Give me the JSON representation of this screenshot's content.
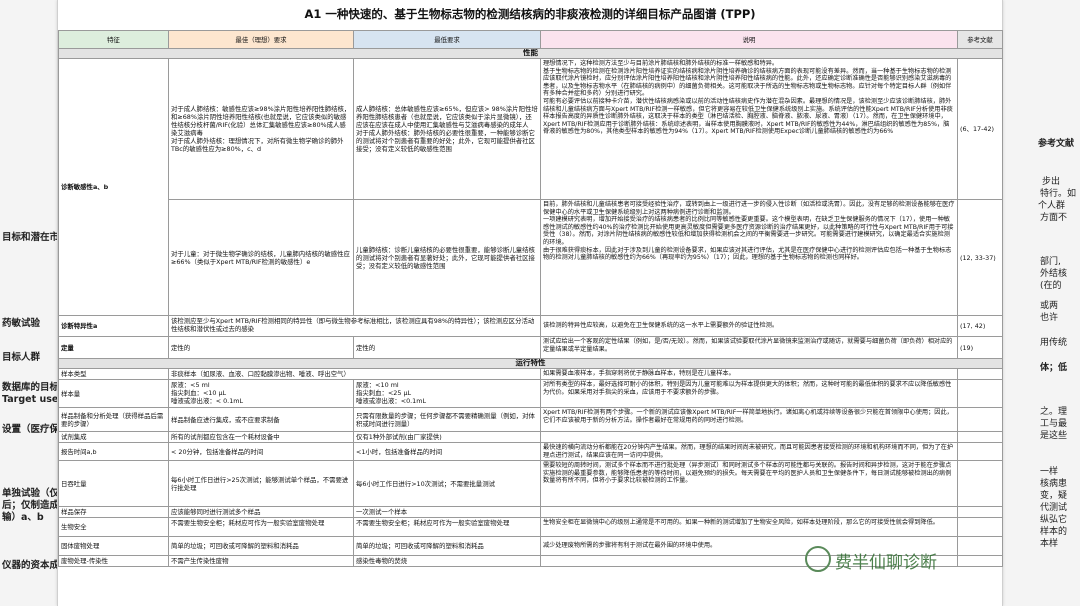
{
  "title": "A1 一种快速的、基于生物标志物的检测结核病的非痰液检测的详细目标产品图谱 (TPP)",
  "headers": [
    "特征",
    "最佳（理想）要求",
    "最低要求",
    "说明",
    "参考文献"
  ],
  "sections": {
    "performance": "性能",
    "operational": "运行特性"
  },
  "rows": {
    "adult": {
      "feat": "诊断敏感性a、b",
      "opt": "对于成人肺结核：敏感性应该≥98%涂片阳性培养阳性肺结核，和≥68%涂片阴性培养阳性结核(也就是说，它应该类似的敏感性结核分枝杆菌/RIF(化验）总体汇集敏感性应该≥80%成人感染艾滋病毒\n对于成人肺外结核：理想情况下，对所有微生物学确诊的肺外TBc的敏感性应为≥80%，c、d",
      "min": "成人肺结核：总体敏感性应该≥65%，但应该> 98%涂片阳性培养阳性肺结核患者（也就是说，它应该类似于涂片显微镜），还应该在应该在成人中使用汇集敏感性与艾滋病毒感染的成年人\n对于成人肺外结核：肺外结核的必要性很重要，一种能够诊断它的测试将对个别患者有重要的好处；此外，它现可能提供者社区接受；没有定义较低的敏感性范围",
      "desc": "理想情况下，这种检测方法至少与目前涂片肺结核和肺外结核的标准一样敏感和特异。\n基于生物标志物的检测在检测涂片阳性培养证实的结核病和涂片阴性培养确诊的结核病方面的表现可能没有差异。然而，当一种基于生物标志物的检测应该取代涂片镜检时，应分别评估涂片阳性培养阳性结核和涂片阴性培养阳性结核病的性能。此外，还应确定诊断准确性是否能够识别感染艾滋病毒的患者，以及生物标志物水平（在肺结核的病例中）的细菌负荷相关。这可能取决于所选的生物标志物或生物标志物。应针对每个特定目标人群（例如伴有多种合并症和多药）分别进行研究。\n可能有必要评估以前接种卡介苗，潜伏性结核病感染或以前的活动性结核病史作为潜在混杂因素。最理想的情况是，该检测至少应该诊断肺结核，肺外结核和儿童结核病方面与Xpert MTB/RIF检测一样敏感，但它将更容易在较低卫生保健系统级别上实施。系统评估的性能Xpert MTB/RIF分析使用非痰样本报告高度的异质性诊断肺外结核，这取决于样本的类型（淋巴结活检、胸腔液、脑脊液、脓液、尿液、胃液）（17）。然而，在卫生保健环境中，Xpert MTB/RIF检测应用于诊断肺外结核：系统综述表明，当样本使用胸膜液时，Xpert MTB/RIF的敏感性为44%，淋巴结组织的敏感性为85%，脑脊液的敏感性为80%，其他类型样本的敏感性为94%（17）。Xpert MTB/RIF检测使用Expec诊断儿童肺结核的敏感性约为66%",
      "ref": "(6、17-42)"
    },
    "child": {
      "opt": "对于儿童：对于微生物学确诊的结核，儿童肺内结核的敏感性应≥66%（类似于Xpert MTB/RIF检测的敏感性）e",
      "min": "儿童肺结核：诊断儿童结核的必要性很重要，能够诊断儿童结核的测试将对个别患者有显著好处；此外，它现可能提供者社区接受；没有定义较低的敏感性范围",
      "desc": "目前，肺外结核和儿童结核患者可接受经验性治疗，或转到由上一级进行进一步的侵入性诊断（如活检或洗胃）。因此，没有足够的检测设备能够在医疗保健中心的水平或卫生保健系统级别上对这两种病例进行诊断和监测。\n一项建模研究表明，增加开始接受治疗的结核病患者的比例比同等敏感性要更重要。这个模型表明，在缺乏卫生保健服务的情况下（17），使用一种敏感性测试的敏感性约40%的治疗检测比开始使用更高灵敏度但需要更多医疗资源诊断的治疗结果更好，以此种策略的可行性与Xpert MTB/RIF用于可接受性（38）。然而，对涂片阴性结核病的敏感性较低和增加获得检测机会之间的平衡需要进一步研究。可能需要进行建模研究，以确定最适合实施检测的环境。\n由于很难获得痰标本，因此对于涉及到儿童的检测设备要求，如果应该对其进行评估，尤其是在医疗保健中心进行的检测评估应包括一种基于生物标志物的检测对儿童肺结核的敏感性约为66%（再现率约为95%）（17）；因此，理想的基于生物标志物的检测也同样好。",
      "ref": "(12, 33-37)"
    },
    "spec": {
      "feat": "诊断特异性a",
      "opt": "该检测应至少与Xpert MTB/RIF检测相同的特异性（即与微生物参考标准相比，该检测应具有98%的特异性）；该检测应区分活动性结核和潜伏性或过去的感染",
      "desc": "该检测的特异性应较高，以避免在卫生保健系统的这一水平上需要额外的验证性检测。",
      "ref": "(17, 42)"
    },
    "quant": {
      "feat": "定量",
      "opt": "定性的",
      "min": "定性的",
      "desc": "测试应给出一个客观的定性结果（例如，是/否/无效）。然而，如果该试验要取代涂片显微镜来监测治疗或随访，就需要与细菌负荷（即负荷）相对应的定量结果或半定量结果。",
      "ref": "(19)"
    },
    "sample": {
      "feat": "样本类型",
      "opt": "非痰样本（如尿液、血液、口腔黏膜渗出物、唾液、呼出空气）",
      "desc": "如果需要血液样本，手指穿刺将优于静脉血样本，特别是在儿童样本。"
    },
    "vol": {
      "feat": "样本量",
      "opt": "尿液：<5 ml\n指尖刺血：<10 μL\n唾液或渗出液：< 0.1mL",
      "min": "尿液：<10 ml\n指尖刺血：<25 μL\n唾液或渗出液：<0.1mL",
      "desc": "对所有类型的样本，最好选择可耐小的体积，特别是因为儿童可能难以为样本提供更大的体积；然而，这种时可能的最低体积的要求不应以降低敏感性为代价。如果采用对手指尖的采血，应该用于不要求额外的步骤。"
    },
    "prep": {
      "feat": "样品制备和分析处理（获得样品后需要的步骤）",
      "opt": "样品制备应进行集成，或不应要求制备",
      "min": "只需有限数量的步骤；任何步骤都不需要精确测量（例如，对体积或时间进行测量）",
      "desc": "Xpert MTB/RIF检测有两个步骤。一个新的测试应该像Xpert MTB/RIF一样简单地执行。诸如离心机或持续等设备很少只能在首领限中心使用；因此，它们不应该被用于新的分析方法。操作者最好在常规用药的同时进行检测。"
    },
    "kit": {
      "feat": "试剂集成",
      "opt": "所有的试剂都应包含在一个耗材设备中",
      "min": "仅有1种外部试剂(由厂家提供)"
    },
    "tat": {
      "feat": "报告时间a,b",
      "opt": "< 20分钟，包括准备样品的时间",
      "min": "<1小时，包括准备样品的时间",
      "desc": "最快速的横向流动分析都能在20分钟内产生结果。然而，理想的结果时间尚未被研究，而且可能因患者接受检测的环境和机构环境而不同，但为了在护理点进行测试，结果应该在同一访问中提供。"
    },
    "thr": {
      "feat": "日吞吐量",
      "opt": "每6小时工作日进行>25次测试；能够测试单个样品，不需要进行批处理",
      "min": "每6小时工作日进行>10次测试；不需要批量测试",
      "desc": "需要较短的周转时间，测试多个样本而不进行批处理（异步测试）和同时测试多个样本的可能性都与关联的。报告时间和异步检测，这对于能在步骤点实施检测的最重要参数，能够降低患者的等待时间，以避免预约的损失。每天需要在平均的医护人员和卫生保健条件下，每日测试能够被检测出的病例数量将有所不同，但将小于要求比较被检测的工作量。"
    },
    "store": {
      "feat": "样品保存",
      "opt": "应该能够同时进行测试多个样品",
      "min": "一次测试一个样本"
    },
    "bio": {
      "feat": "生物安全",
      "opt": "不需要生物安全柜；耗材应可作为一般实验室废物处理",
      "min": "不需要生物安全柜；耗材应可作为一般实验室废物处理",
      "desc": "生物安全柜在显微镜中心的级别上通常是不可用的。如果一种新的测试增加了生物安全风险，如样本处理阶段，那么它的可接受性就会得到降低。"
    },
    "waste": {
      "feat": "固体废物处理",
      "opt": "简单的垃圾；可回收或可降解的塑料和消耗品",
      "min": "简单的垃圾；可回收或可降解的塑料和消耗品",
      "desc": "减少处理废物所需的步骤将有利于测试在最外围的环境中使用。"
    },
    "last": {
      "feat": "废物处理-传染性",
      "opt": "不需产生传染性废物",
      "min": "感染性毒物的焚烧"
    }
  },
  "side_left": [
    "目标和潜在市",
    "药敏试验",
    "目标人群",
    "数据库的目标",
    "Target user",
    "设置（医疗保",
    "单独试验（仅",
    "后；仅制造成",
    "输）a、b",
    "仪器的资本成"
  ],
  "side_right": [
    "参考文献",
    "步出",
    "特行。如",
    "个人群",
    "方面不",
    "部门,",
    "外结核",
    "(在的",
    "或两",
    "也许",
    "用传统",
    "体；低",
    "之。理",
    "工与最",
    "是这些",
    "一样",
    "核病患",
    "变，疑",
    "代测试",
    "纵弘它",
    "样本的",
    "本样"
  ],
  "watermark": "费半仙聊诊断"
}
